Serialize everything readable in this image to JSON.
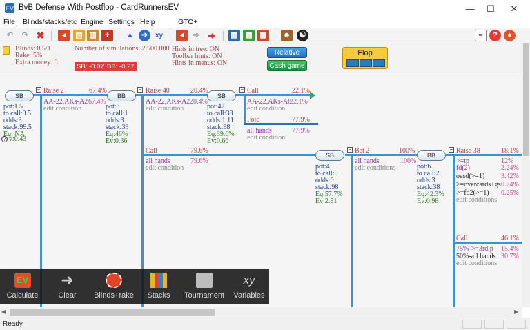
{
  "window": {
    "title": "BvB Defense With Postflop - CardRunnersEV",
    "min": "—",
    "max": "☐",
    "close": "✕"
  },
  "menu": [
    "File",
    "Blinds/stacks/etc",
    "Engine",
    "Settings",
    "Help",
    "GTO+"
  ],
  "info": {
    "blinds": "Blinds: 0.5/1",
    "rake": "Rake: 5%",
    "extra": "Extra money: 0",
    "sims": "Number of simulations: 2.500.000",
    "sb": "SB: -0.07",
    "bb": "BB: -0.27",
    "hints1": "Hints in tree: ON",
    "hints2": "Toolbar hints: ON",
    "hints3": "Hints in menus: ON",
    "relative": "Relative",
    "cashgame": "Cash game",
    "flop": "Flop"
  },
  "colors": {
    "node_line": "#3b93d3",
    "accent": "#2aa44f",
    "tag": "#e33b3b"
  },
  "tree": {
    "n1": {
      "label": "SB",
      "pot": "pot:1.5",
      "tocall": "to call:0.5",
      "odds": "odds:3",
      "stack": "stack:99.5",
      "eq": "Eq: NA",
      "ev": "v:0.43"
    },
    "a1": {
      "label": "Raise 2",
      "pct": "67.4%",
      "range": "AA-22,AKs-A2",
      "rpct": "67.4%",
      "edit": "edit condition"
    },
    "n2": {
      "label": "BB",
      "pot": "pot:3",
      "tocall": "to call:1",
      "odds": "odds:3",
      "stack": "stack:39",
      "eq": "Eq:46%",
      "ev": "Ev:0.36"
    },
    "a2": {
      "label": "Raise 40",
      "pct": "20.4%",
      "range": "AA-22,AKs-A2",
      "rpct": "20.4%",
      "edit": "edit condition"
    },
    "n3": {
      "label": "SB",
      "pot": "pot:42",
      "tocall": "to call:38",
      "odds": "odds:1.11",
      "stack": "stack:98",
      "eq": "Eq:39.6%",
      "ev": "Ev:0.66"
    },
    "a3": {
      "label": "Call",
      "pct": "22.1%",
      "range": "AA-22,AKs-A8",
      "rpct": "22.1%",
      "edit": "edit condition"
    },
    "a4": {
      "label": "Fold",
      "pct": "77.9%",
      "range": "all hands",
      "rpct": "77.9%",
      "edit": "edit condition"
    },
    "a5": {
      "label": "Call",
      "pct": "79.6%",
      "range": "all hands",
      "rpct": "79.6%",
      "edit": "edit condition"
    },
    "n4": {
      "label": "SB",
      "pot": "pot:4",
      "tocall": "to call:0",
      "odds": "odds:0",
      "stack": "stack:98",
      "eq": "Eq:57.7%",
      "ev": "Ev:2.51"
    },
    "a6": {
      "label": "Bet 2",
      "pct": "100%",
      "range": "all hands",
      "rpct": "100%",
      "edit": "edit conditions"
    },
    "n5": {
      "label": "BB",
      "pot": "pot:6",
      "tocall": "to call:2",
      "odds": "odds:3",
      "stack": "stack:38",
      "eq": "Eq:42.3%",
      "ev": "Ev:0.98"
    },
    "a7": {
      "label": "Raise 38",
      "pct": "18.1%",
      "rows": [
        {
          "h": ">=tp",
          "p": "12%"
        },
        {
          "h": "fd(2)",
          "p": "2.24%"
        },
        {
          "h": "oesd(>=1)",
          "p": "3.42%"
        },
        {
          "h": ">=overcards+gs",
          "p": "0.24%"
        },
        {
          "h": ">=fd2(>=1)",
          "p": "0.25%"
        }
      ],
      "edit": "edit conditions"
    },
    "a8": {
      "label": "Call",
      "pct": "46.1%",
      "rows": [
        {
          "h": "75%->=3rd p",
          "p": "15.4%"
        },
        {
          "h": "50%-all hands",
          "p": "30.7%"
        }
      ],
      "edit": "edit conditions"
    }
  },
  "actions": [
    {
      "label": "Calculate",
      "icon": "ev-icon"
    },
    {
      "label": "Clear",
      "icon": "arrow-icon"
    },
    {
      "label": "Blinds+rake",
      "icon": "chip-icon"
    },
    {
      "label": "Stacks",
      "icon": "stacks-icon"
    },
    {
      "label": "Tournament",
      "icon": "tournament-icon"
    },
    {
      "label": "Variables",
      "icon": "xy-icon"
    }
  ],
  "status": "Ready"
}
